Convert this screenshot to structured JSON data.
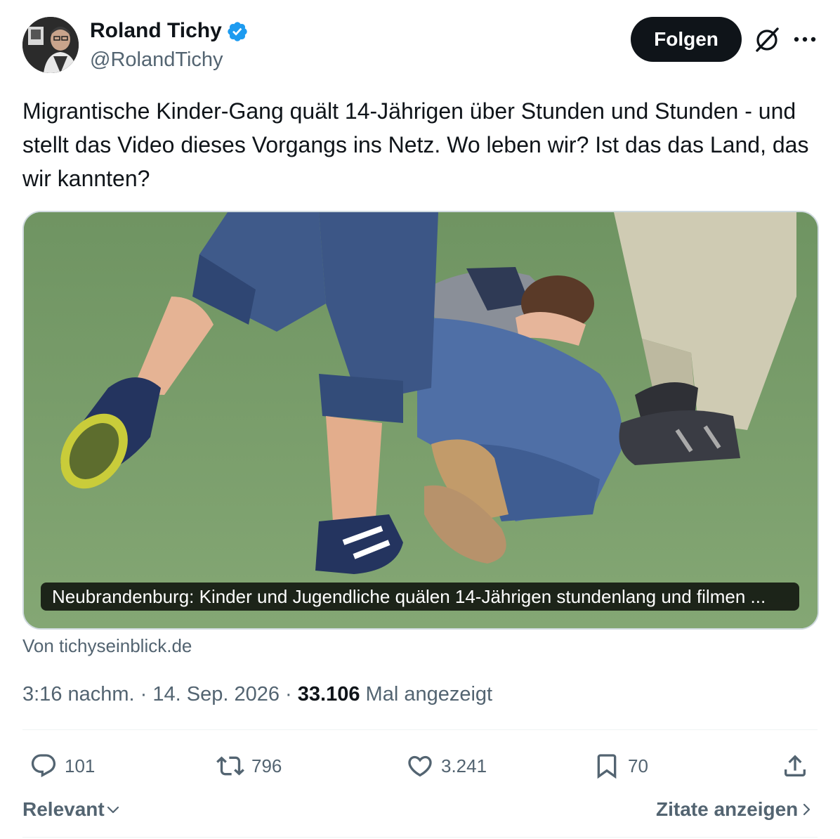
{
  "author": {
    "name": "Roland Tichy",
    "handle": "@RolandTichy",
    "verified_color": "#1d9bf0"
  },
  "header": {
    "follow_label": "Folgen",
    "grok_icon": "grok-icon",
    "more_icon": "more-icon"
  },
  "tweet": {
    "text": "Migrantische Kinder-Gang quält 14-Jährigen über Stunden und Stunden - und stellt das Video dieses Vorgangs ins Netz. Wo leben wir? Ist das das Land, das wir kannten?"
  },
  "card": {
    "caption": "Neubrandenburg: Kinder und Jugendliche quälen 14-Jährigen stundenlang und filmen ...",
    "source": "Von tichyseinblick.de"
  },
  "meta": {
    "time": "3:16 nachm.",
    "sep1": " · ",
    "date": "14. Sep. 2026",
    "sep2": " · ",
    "views": "33.106",
    "views_label": " Mal angezeigt"
  },
  "actions": {
    "replies": "101",
    "reposts": "796",
    "likes": "3.241",
    "bookmarks": "70"
  },
  "footer": {
    "sort_label": "Relevant",
    "quotes_label": "Zitate anzeigen"
  }
}
